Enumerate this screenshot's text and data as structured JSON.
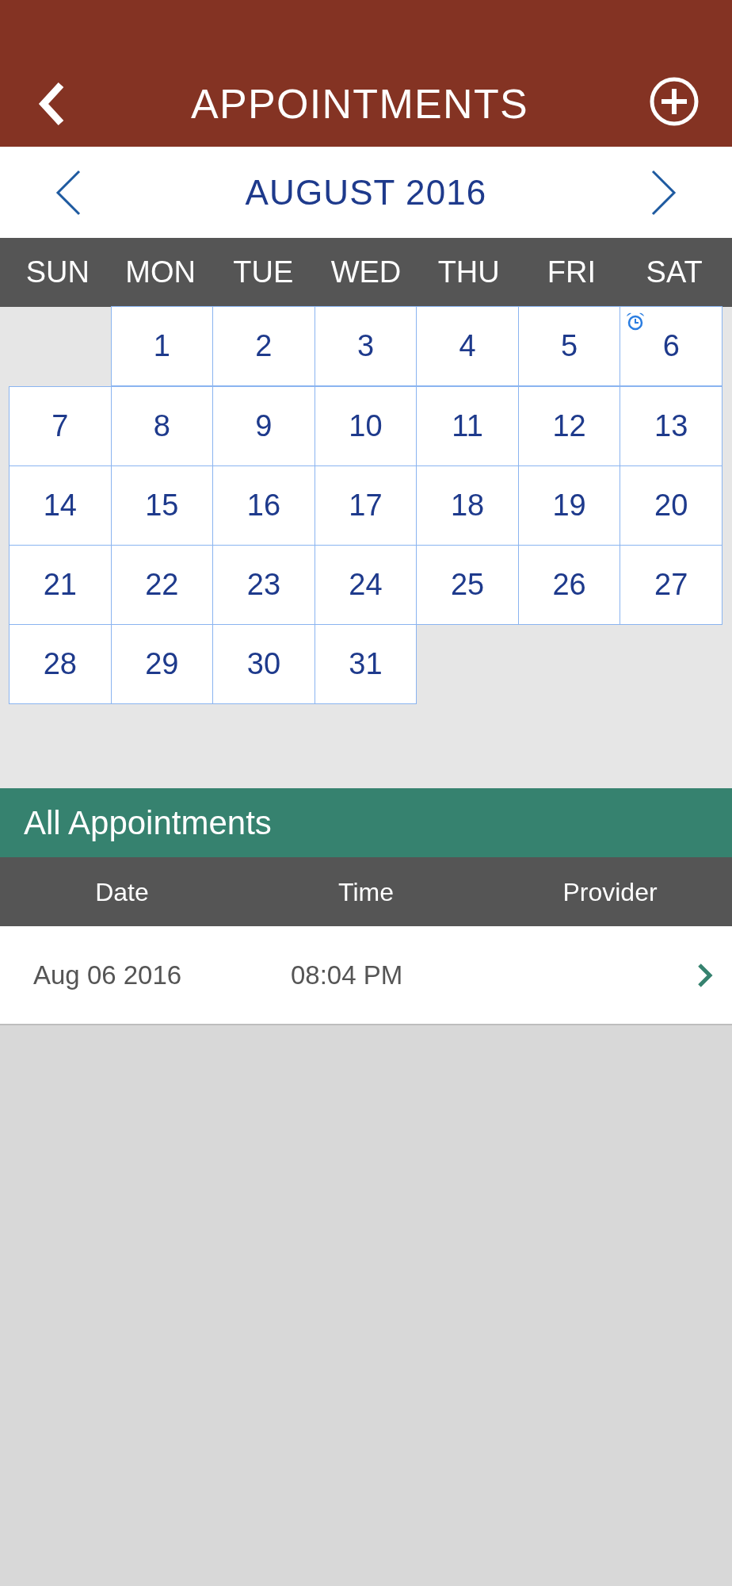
{
  "header": {
    "title": "APPOINTMENTS"
  },
  "calendar": {
    "month": "AUGUST 2016",
    "weekdays": [
      "SUN",
      "MON",
      "TUE",
      "WED",
      "THU",
      "FRI",
      "SAT"
    ],
    "days": [
      {
        "kind": "blank"
      },
      {
        "kind": "day",
        "label": "1",
        "has_alarm": false
      },
      {
        "kind": "day",
        "label": "2",
        "has_alarm": false
      },
      {
        "kind": "day",
        "label": "3",
        "has_alarm": false
      },
      {
        "kind": "day",
        "label": "4",
        "has_alarm": false
      },
      {
        "kind": "day",
        "label": "5",
        "has_alarm": false
      },
      {
        "kind": "day",
        "label": "6",
        "has_alarm": true
      },
      {
        "kind": "day",
        "label": "7",
        "has_alarm": false
      },
      {
        "kind": "day",
        "label": "8",
        "has_alarm": false
      },
      {
        "kind": "day",
        "label": "9",
        "has_alarm": false
      },
      {
        "kind": "day",
        "label": "10",
        "has_alarm": false
      },
      {
        "kind": "day",
        "label": "11",
        "has_alarm": false
      },
      {
        "kind": "day",
        "label": "12",
        "has_alarm": false
      },
      {
        "kind": "day",
        "label": "13",
        "has_alarm": false
      },
      {
        "kind": "day",
        "label": "14",
        "has_alarm": false
      },
      {
        "kind": "day",
        "label": "15",
        "has_alarm": false
      },
      {
        "kind": "day",
        "label": "16",
        "has_alarm": false
      },
      {
        "kind": "day",
        "label": "17",
        "has_alarm": false
      },
      {
        "kind": "day",
        "label": "18",
        "has_alarm": false
      },
      {
        "kind": "day",
        "label": "19",
        "has_alarm": false
      },
      {
        "kind": "day",
        "label": "20",
        "has_alarm": false
      },
      {
        "kind": "day",
        "label": "21",
        "has_alarm": false
      },
      {
        "kind": "day",
        "label": "22",
        "has_alarm": false
      },
      {
        "kind": "day",
        "label": "23",
        "has_alarm": false
      },
      {
        "kind": "day",
        "label": "24",
        "has_alarm": false
      },
      {
        "kind": "day",
        "label": "25",
        "has_alarm": false
      },
      {
        "kind": "day",
        "label": "26",
        "has_alarm": false
      },
      {
        "kind": "day",
        "label": "27",
        "has_alarm": false
      },
      {
        "kind": "day",
        "label": "28",
        "has_alarm": false
      },
      {
        "kind": "day",
        "label": "29",
        "has_alarm": false
      },
      {
        "kind": "day",
        "label": "30",
        "has_alarm": false
      },
      {
        "kind": "day",
        "label": "31",
        "has_alarm": false
      }
    ]
  },
  "appointments": {
    "title": "All Appointments",
    "columns": [
      "Date",
      "Time",
      "Provider"
    ],
    "rows": [
      {
        "date": "Aug 06 2016",
        "time": "08:04 PM"
      }
    ]
  }
}
